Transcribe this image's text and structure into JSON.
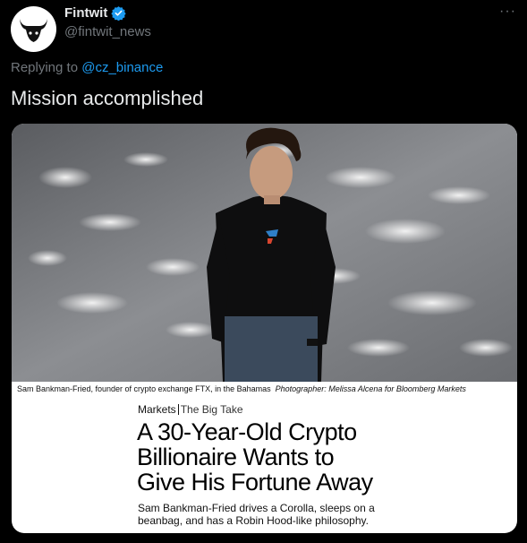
{
  "author": {
    "display_name": "Fintwit",
    "handle": "@fintwit_news",
    "avatar_icon": "bull-logo-icon",
    "verified_icon": "verified-badge-icon"
  },
  "more_label": "···",
  "reply": {
    "prefix": "Replying to ",
    "mention": "@cz_binance"
  },
  "tweet_text": "Mission accomplished",
  "card": {
    "caption": "Sam Bankman-Fried, founder of crypto exchange FTX, in the Bahamas",
    "credit": "Photographer: Melissa Alcena for Bloomberg Markets",
    "section": "Markets",
    "subsection": "The Big Take",
    "headline_lines": [
      "A 30-Year-Old Crypto",
      "Billionaire Wants to",
      "Give His Fortune Away"
    ],
    "dek": "Sam Bankman-Fried drives a Corolla, sleeps on a beanbag, and has a Robin Hood-like philosophy."
  },
  "colors": {
    "background": "#000000",
    "link": "#1d9bf0",
    "muted": "#71767b",
    "text": "#e7e9ea"
  }
}
